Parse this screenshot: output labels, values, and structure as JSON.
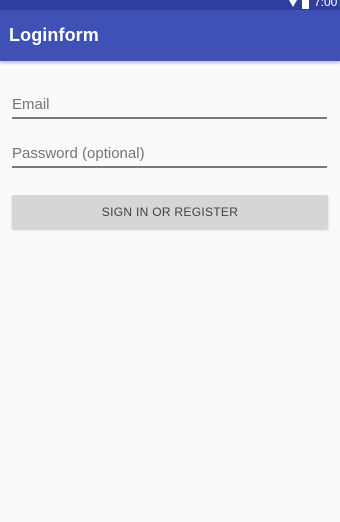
{
  "status_bar": {
    "time": "7:00",
    "icons": [
      "wifi-icon",
      "battery-icon"
    ],
    "color": "#303f9f"
  },
  "app_bar": {
    "title": "Loginform",
    "color": "#3f51b5"
  },
  "form": {
    "email_label": "Email",
    "password_label": "Password (optional)",
    "submit_label": "SIGN IN OR REGISTER"
  }
}
